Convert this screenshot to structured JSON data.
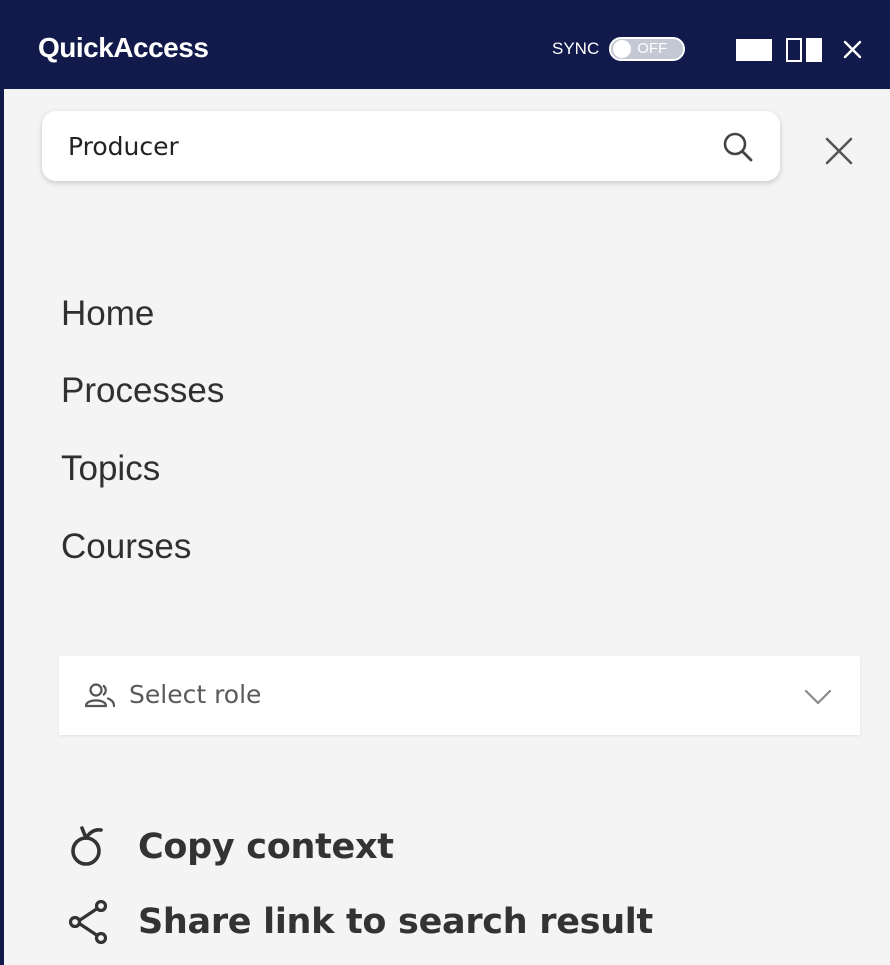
{
  "header": {
    "title": "QuickAccess",
    "sync_label": "SYNC",
    "sync_state": "OFF",
    "close_glyph": "×"
  },
  "search": {
    "value": "Producer",
    "placeholder": ""
  },
  "nav": {
    "items": [
      {
        "label": "Home"
      },
      {
        "label": "Processes"
      },
      {
        "label": "Topics"
      },
      {
        "label": "Courses"
      }
    ]
  },
  "role_select": {
    "label": "Select role"
  },
  "actions": [
    {
      "label": "Copy context",
      "icon": "copy-context-icon"
    },
    {
      "label": "Share link to search result",
      "icon": "share-icon"
    }
  ],
  "colors": {
    "header_bg": "#121a4c",
    "panel_bg": "#f4f4f4",
    "text": "#303030"
  }
}
